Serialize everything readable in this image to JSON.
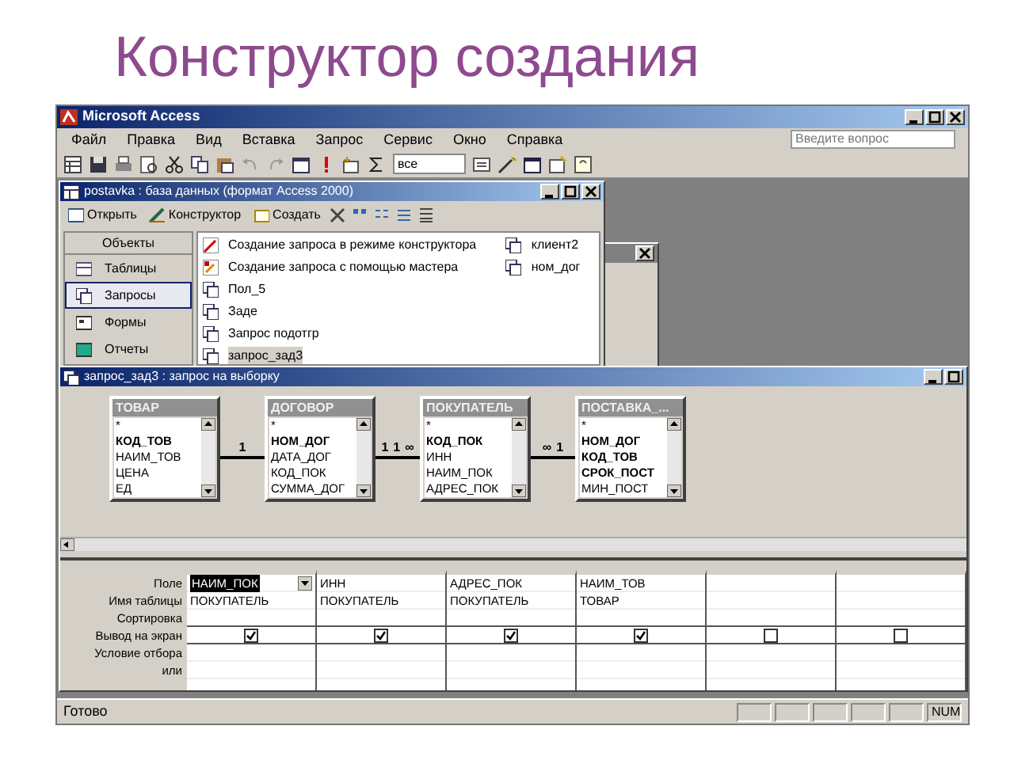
{
  "slide_title": "Конструктор создания",
  "window": {
    "title": "Microsoft Access"
  },
  "menu": [
    "Файл",
    "Правка",
    "Вид",
    "Вставка",
    "Запрос",
    "Сервис",
    "Окно",
    "Справка"
  ],
  "help_box": {
    "placeholder": "Введите вопрос"
  },
  "toolbar": {
    "top_values": "все"
  },
  "database_window": {
    "title": "postavka : база данных (формат Access 2000)",
    "buttons": [
      "Открыть",
      "Конструктор",
      "Создать"
    ],
    "objects_header": "Объекты",
    "objects": [
      {
        "label": "Таблицы",
        "selected": false
      },
      {
        "label": "Запросы",
        "selected": true
      },
      {
        "label": "Формы",
        "selected": false
      },
      {
        "label": "Отчеты",
        "selected": false
      }
    ],
    "items": [
      {
        "label": "Создание запроса в режиме конструктора",
        "kind": "design",
        "selected": false
      },
      {
        "label": "Создание запроса с помощью мастера",
        "kind": "wizard",
        "selected": false
      },
      {
        "label": "Пол_5",
        "kind": "query",
        "selected": false
      },
      {
        "label": "Заде",
        "kind": "query",
        "selected": false
      },
      {
        "label": "Запрос подотгр",
        "kind": "query",
        "selected": false
      },
      {
        "label": "запрос_зад3",
        "kind": "query",
        "selected": true
      },
      {
        "label": "клиент2",
        "kind": "query",
        "selected": false
      },
      {
        "label": "ном_дог",
        "kind": "query",
        "selected": false
      }
    ]
  },
  "query_window": {
    "title": "запрос_зад3 : запрос на выборку",
    "tables": [
      {
        "name": "ТОВАР",
        "fields": [
          {
            "name": "*",
            "key": false
          },
          {
            "name": "КОД_ТОВ",
            "key": true
          },
          {
            "name": "НАИМ_ТОВ",
            "key": false
          },
          {
            "name": "ЦЕНА",
            "key": false
          },
          {
            "name": "ЕД",
            "key": false
          }
        ]
      },
      {
        "name": "ДОГОВОР",
        "fields": [
          {
            "name": "*",
            "key": false
          },
          {
            "name": "НОМ_ДОГ",
            "key": true
          },
          {
            "name": "ДАТА_ДОГ",
            "key": false
          },
          {
            "name": "КОД_ПОК",
            "key": false
          },
          {
            "name": "СУММА_ДОГ",
            "key": false
          }
        ]
      },
      {
        "name": "ПОКУПАТЕЛЬ",
        "fields": [
          {
            "name": "*",
            "key": false
          },
          {
            "name": "КОД_ПОК",
            "key": true
          },
          {
            "name": "ИНН",
            "key": false
          },
          {
            "name": "НАИМ_ПОК",
            "key": false
          },
          {
            "name": "АДРЕС_ПОК",
            "key": false
          }
        ]
      },
      {
        "name": "ПОСТАВКА_...",
        "fields": [
          {
            "name": "*",
            "key": false
          },
          {
            "name": "НОМ_ДОГ",
            "key": true
          },
          {
            "name": "КОД_ТОВ",
            "key": true
          },
          {
            "name": "СРОК_ПОСТ",
            "key": true
          },
          {
            "name": "МИН_ПОСТ",
            "key": false
          }
        ]
      }
    ],
    "links": [
      [
        "1"
      ],
      [
        "1",
        "1",
        "∞"
      ],
      [
        "∞",
        "1"
      ]
    ]
  },
  "grid": {
    "row_labels": [
      "Поле",
      "Имя таблицы",
      "Сортировка",
      "Вывод на экран",
      "Условие отбора",
      "или"
    ],
    "columns": [
      {
        "field": "НАИМ_ПОК",
        "table": "ПОКУПАТЕЛЬ",
        "show": true,
        "selected": true
      },
      {
        "field": "ИНН",
        "table": "ПОКУПАТЕЛЬ",
        "show": true,
        "selected": false
      },
      {
        "field": "АДРЕС_ПОК",
        "table": "ПОКУПАТЕЛЬ",
        "show": true,
        "selected": false
      },
      {
        "field": "НАИМ_ТОВ",
        "table": "ТОВАР",
        "show": true,
        "selected": false
      },
      {
        "show": false,
        "selected": false
      },
      {
        "show": false,
        "selected": false
      }
    ]
  },
  "status_bar": {
    "text": "Готово",
    "indicator": "NUM"
  }
}
